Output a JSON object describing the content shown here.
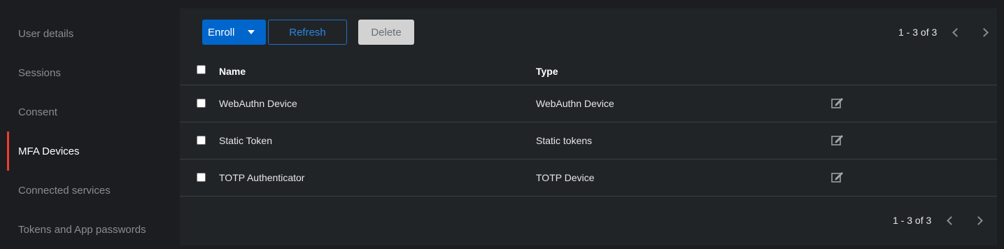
{
  "sidebar": {
    "items": [
      {
        "label": "User details",
        "active": false
      },
      {
        "label": "Sessions",
        "active": false
      },
      {
        "label": "Consent",
        "active": false
      },
      {
        "label": "MFA Devices",
        "active": true
      },
      {
        "label": "Connected services",
        "active": false
      },
      {
        "label": "Tokens and App passwords",
        "active": false
      }
    ]
  },
  "toolbar": {
    "enroll_label": "Enroll",
    "refresh_label": "Refresh",
    "delete_label": "Delete",
    "pagination": "1 - 3 of 3"
  },
  "table": {
    "columns": [
      "Name",
      "Type"
    ],
    "rows": [
      {
        "name": "WebAuthn Device",
        "type": "WebAuthn Device"
      },
      {
        "name": "Static Token",
        "type": "Static tokens"
      },
      {
        "name": "TOTP Authenticator",
        "type": "TOTP Device"
      }
    ]
  },
  "footer": {
    "pagination": "1 - 3 of 3"
  },
  "icons": {
    "edit": "edit-icon",
    "prev": "chevron-left-icon",
    "next": "chevron-right-icon",
    "dropdown": "caret-down-icon"
  },
  "colors": {
    "accent": "#0066cc",
    "active_indicator": "#ee3e30",
    "background": "#1b1d21",
    "panel": "#212427"
  }
}
